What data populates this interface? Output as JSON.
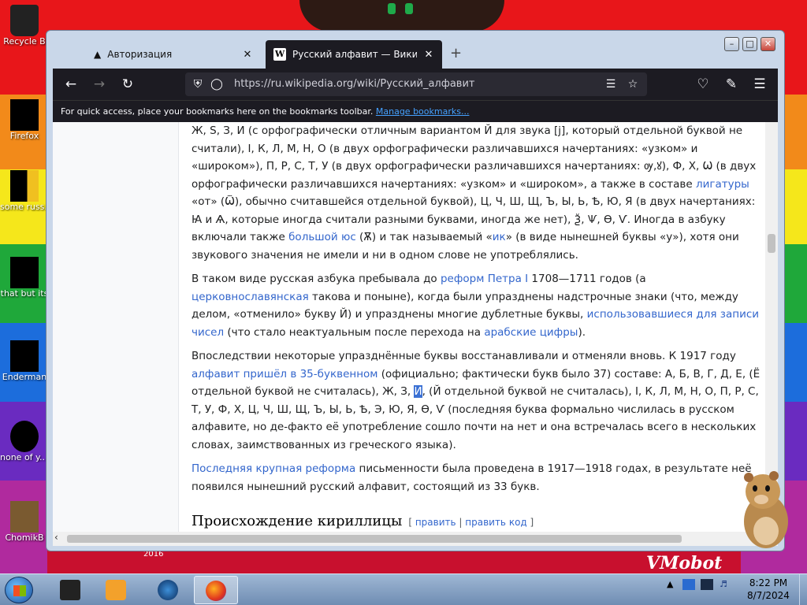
{
  "desktop": {
    "icons": [
      {
        "label": "Recycle B"
      },
      {
        "label": "Firefox"
      },
      {
        "label": "some russ... ran a ra"
      },
      {
        "label": "that but its"
      },
      {
        "label": "Enderman"
      },
      {
        "label": "none of y... retards kn"
      },
      {
        "label": "ChomikB"
      }
    ],
    "wallpaper_text": "VMobot",
    "wallpaper_year": "2016"
  },
  "browser": {
    "tabs": [
      {
        "label": "Авторизация",
        "close": "✕",
        "active": false
      },
      {
        "label": "Русский алфавит — Википеди",
        "close": "✕",
        "active": true
      }
    ],
    "new_tab": "+",
    "window_controls": {
      "minimize": "–",
      "maximize": "□",
      "close": "✕"
    },
    "url": "https://ru.wikipedia.org/wiki/Русский_алфавит",
    "bookmarks_bar": {
      "text": "For quick access, place your bookmarks here on the bookmarks toolbar.",
      "link": "Manage bookmarks..."
    }
  },
  "article": {
    "p1": {
      "t1": "Ж, S, З, И (с орфографически отличным вариантом Й для звука [j], который отдельной буквой не считали), І, К, Л, М, Н, О (в двух орфографически различавшихся начертаниях: «узком» и «широком»), П, Р, С, Т, У (в двух орфографически различавшихся начертаниях: ",
      "glyph1": "ѹ,ꙋ",
      "t2": "), Ф, Х, Ѡ (в двух орфографически различавшихся начертаниях: «узком» и «широком», а также в составе ",
      "link_ligatures": "лигатуры",
      "t3": " «от» (",
      "glyph2": "Ѿ",
      "t4": "), обычно считавшейся отдельной буквой), Ц, Ч, Ш, Щ, Ъ, Ы, Ь, Ѣ, Ю, Я (в двух начертаниях: ",
      "glyph3": "Ꙗ",
      "t5": " и Ѧ, которые иногда считали разными буквами, иногда же нет), Ѯ, Ѱ, Ѳ, Ѵ. Иногда в азбуку включали также ",
      "link_yus": "большой юс",
      "t6": " (Ѫ) и так называемый «",
      "link_ik": "ик",
      "t7": "» (в виде нынешней буквы «у»), хотя они звукового значения не имели и ни в одном слове не употреблялись."
    },
    "p2": {
      "t1": "В таком виде русская азбука пребывала до ",
      "link_reforms": "реформ Петра I",
      "t2": " 1708—1711 годов (а ",
      "link_church": "церковнославянская",
      "t3": " такова и поныне), когда были упразднены надстрочные знаки (что, между делом, «отменило» букву Й) и упразднены многие дублетные буквы, ",
      "link_numbers": "использовавшиеся для записи чисел",
      "t4": " (что стало неактуальным после перехода на ",
      "link_arabic": "арабские цифры",
      "t5": ")."
    },
    "p3": {
      "t1": "Впоследствии некоторые упразднённые буквы восстанавливали и отменяли вновь. К 1917 году ",
      "link_alphabet": "алфавит пришёл в 35-буквенном",
      "t2": " (официально; фактически букв было 37) составе: А, Б, В, Г, Д, Е, (Ё отдельной буквой не считалась), Ж, З, ",
      "selected": "И",
      "t3": ", (Й отдельной буквой не считалась), І, К, Л, М, Н, О, П, Р, С, Т, У, Ф, Х, Ц, Ч, Ш, Щ, Ъ, Ы, Ь, Ѣ, Э, Ю, Я, Ѳ, Ѵ (последняя буква формально числилась в русском алфавите, но де-факто её употребление сошло почти на нет и она встречалась всего в нескольких словах, заимствованных из греческого языка)."
    },
    "p4": {
      "link_reform": "Последняя крупная реформа",
      "t1": " письменности была проведена в 1917—1918 годах, в результате неё появился нынешний русский алфавит, состоящий из 33 букв."
    },
    "heading": "Происхождение кириллицы",
    "edit_open": "[ ",
    "edit_link": "править",
    "edit_sep": " | ",
    "edit_code_link": "править код",
    "edit_close": " ]"
  },
  "taskbar": {
    "time": "8:22 PM",
    "date": "8/7/2024"
  }
}
